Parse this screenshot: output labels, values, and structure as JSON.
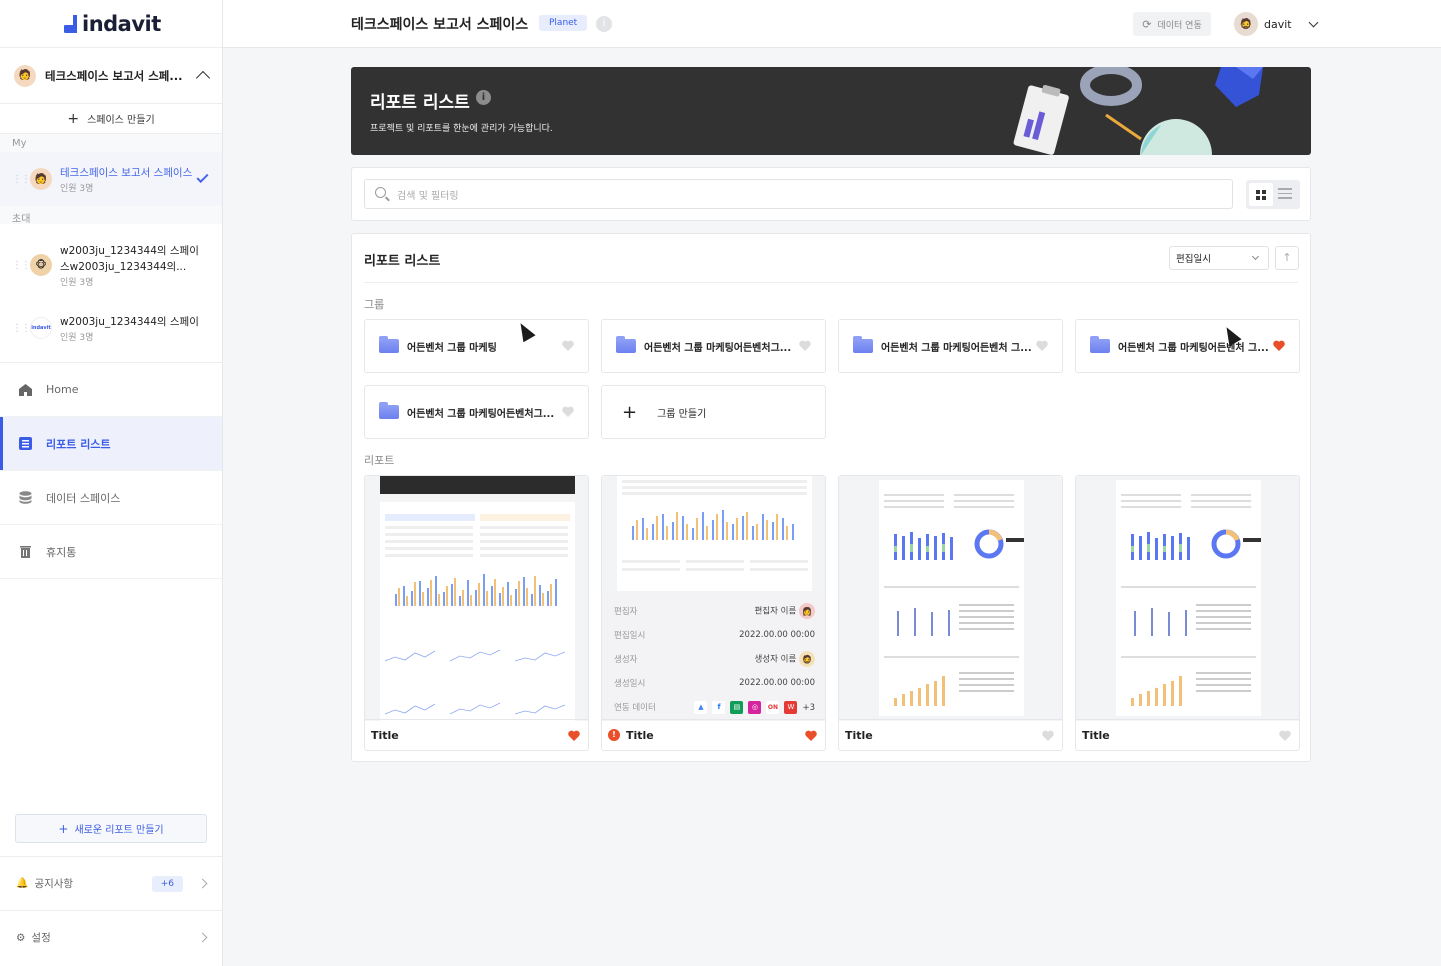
{
  "app": {
    "brand": "indavit"
  },
  "sidebar": {
    "current_space": "테크스페이스 보고서 스페...",
    "create_space": "스페이스 만들기",
    "section_my": "My",
    "section_invite": "초대",
    "my_spaces": [
      {
        "name": "테크스페이스 보고서 스페이스",
        "members": "인원 3명"
      }
    ],
    "invited_spaces": [
      {
        "name_line1": "w2003ju_1234344의 스페이",
        "name_line2": "스w2003ju_1234344의...",
        "members": "인원 3명"
      },
      {
        "name_line1": "w2003ju_1234344의 스페이",
        "members": "인원 3명",
        "logo_text": "indavit"
      }
    ],
    "nav": [
      {
        "label": "Home",
        "icon": "home-icon"
      },
      {
        "label": "리포트 리스트",
        "icon": "list-icon",
        "active": true
      },
      {
        "label": "데이터 스페이스",
        "icon": "database-icon"
      },
      {
        "label": "휴지통",
        "icon": "trash-icon"
      }
    ],
    "new_report": "새로운 리포트 만들기",
    "notice_label": "공지사항",
    "notice_badge": "+6",
    "settings_label": "설정"
  },
  "header": {
    "title": "테크스페이스 보고서 스페이스",
    "badge": "Planet",
    "info": "i",
    "data_link": "데이터 연동",
    "user": "davit"
  },
  "banner": {
    "title": "리포트 리스트",
    "subtitle": "프로젝트 및 리포트를 한눈에 관리가 가능합니다."
  },
  "search": {
    "placeholder": "검색 및 필터링"
  },
  "list": {
    "title": "리포트 리스트",
    "sort_label": "편집일시",
    "groups_label": "그룹",
    "reports_label": "리포트",
    "groups": [
      {
        "name": "어든벤처 그룹 마케팅",
        "liked": false
      },
      {
        "name": "어든벤처 그룹 마케팅어든벤처그...",
        "liked": false
      },
      {
        "name": "어든벤처 그룹 마케팅어든벤처 그...",
        "liked": false
      },
      {
        "name": "어든벤처 그룹 마케팅어든벤처 그...",
        "liked": true
      },
      {
        "name": "어든벤처 그룹 마케팅어든벤처그...",
        "liked": false
      }
    ],
    "create_group": "그룹 만들기",
    "reports": [
      {
        "title": "Title",
        "liked": true,
        "error": false
      },
      {
        "title": "Title",
        "liked": true,
        "error": true
      },
      {
        "title": "Title",
        "liked": false,
        "error": false
      },
      {
        "title": "Title",
        "liked": false,
        "error": false
      }
    ],
    "hover_meta": {
      "editor_k": "편집자",
      "editor_v": "편집자 이름",
      "edited_k": "편집일시",
      "edited_v": "2022.00.00 00:00",
      "creator_k": "생성자",
      "creator_v": "생성자 이름",
      "created_k": "생성일시",
      "created_v": "2022.00.00 00:00",
      "linked_k": "연동 데이터",
      "linked_more": "+3"
    }
  },
  "colors": {
    "accent": "#3b5ce4",
    "heart_on": "#e9502a",
    "heart_off": "#dcdcdc"
  }
}
